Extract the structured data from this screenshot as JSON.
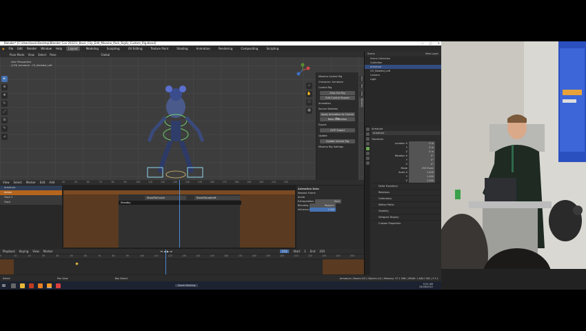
{
  "window": {
    "title": "Blender* [C:\\Users\\kock\\Desktop\\Blender Con 2022\\1_Basic_Clip_Edit_Mixamo_Pack_Rigify_Custom_Rig.blend]",
    "controls": [
      "—",
      "□",
      "✕"
    ]
  },
  "menubar": {
    "menus": [
      "File",
      "Edit",
      "Render",
      "Window",
      "Help"
    ],
    "workspaces": [
      "Layout",
      "Modeling",
      "Sculpting",
      "UV Editing",
      "Texture Paint",
      "Shading",
      "Animation",
      "Rendering",
      "Compositing",
      "Scripting"
    ],
    "active_workspace": "Layout"
  },
  "viewport": {
    "mode": "Pose Mode",
    "menus": [
      "View",
      "Select",
      "Pose"
    ],
    "transform": "Global",
    "overlay_text": [
      "User Perspective",
      "(153) Armature : CH_Modded_Left"
    ]
  },
  "npanel": {
    "items": [
      "Mixamo Control Rig",
      "Character: Armature",
      "Control Rig",
      "Zero Out Rig",
      "Edit Control Shapes",
      "Animation",
      "Source Skeleton",
      "Apply Animation to Control Rig",
      "Bake Animation",
      "Export",
      "GLTF Export",
      "Update",
      "Update Control Rig",
      "Mixamo Rig Settings"
    ],
    "tabs": [
      "Item",
      "Tool",
      "View",
      "Mixamo"
    ]
  },
  "nla": {
    "menus": [
      "View",
      "Select",
      "Marker",
      "Edit",
      "Add"
    ],
    "tracks": [
      "Armature",
      "Action",
      "Track 2",
      "Track"
    ],
    "ruler": [
      "40",
      "50",
      "60",
      "70",
      "80",
      "90",
      "100",
      "110",
      "120",
      "130",
      "140",
      "150",
      "160",
      "170",
      "180",
      "190",
      "200",
      "210",
      "220"
    ],
    "strips": [
      "StandToCrouch",
      "StandToLookLeft",
      "Standby"
    ],
    "props": {
      "header": "Animation Data",
      "action": "dumb",
      "extrapolation_label": "Extrapolation",
      "extrapolation": "Hold",
      "blending_label": "Blending",
      "blending": "Replace",
      "influence_label": "Influence",
      "influence": "1.000",
      "tab": "Nearest Frame"
    }
  },
  "timeline": {
    "menus": [
      "Playback",
      "Keying",
      "View",
      "Marker"
    ],
    "frame_current": "153",
    "start": "1",
    "end": "250",
    "start_label": "Start",
    "end_label": "End",
    "ruler": [
      "0",
      "10",
      "20",
      "30",
      "40",
      "50",
      "60",
      "70",
      "80",
      "90",
      "100",
      "110",
      "120",
      "130",
      "140",
      "150",
      "160",
      "170",
      "180",
      "190",
      "200",
      "210",
      "220",
      "230",
      "240",
      "250"
    ]
  },
  "outliner": {
    "title": "Scene",
    "view_layer": "View Layer",
    "rows": [
      "Scene Collection",
      "Collection",
      "Armature",
      "CH_Modded_Left",
      "Camera",
      "Light"
    ],
    "selected": "Armature"
  },
  "properties": {
    "object": "Armature",
    "sub": "Armature",
    "transform": "Transform",
    "fields": [
      {
        "label": "Location X",
        "value": "0 m"
      },
      {
        "label": "Y",
        "value": "0 m"
      },
      {
        "label": "Z",
        "value": "0 m"
      },
      {
        "label": "Rotation X",
        "value": "0°"
      },
      {
        "label": "Y",
        "value": "0°"
      },
      {
        "label": "Z",
        "value": "0°"
      },
      {
        "label": "Mode",
        "value": "XYZ Euler"
      },
      {
        "label": "Scale X",
        "value": "1.000"
      },
      {
        "label": "Y",
        "value": "1.000"
      },
      {
        "label": "Z",
        "value": "1.000"
      }
    ],
    "sections": [
      "Delta Transform",
      "Relations",
      "Collections",
      "Motion Paths",
      "Visibility",
      "Viewport Display",
      "Custom Properties"
    ]
  },
  "statusbar": {
    "left": "Select",
    "middle": "Pan View",
    "right": "Box Select",
    "info": "Armature | Bones:0/0 | Objects:1/4 | Memory: 37.1 MiB | VRAM: 1.6/8.0 GiB | 3.3.1"
  },
  "taskbar": {
    "active_app": "Zoom Meeting",
    "time": "9:25 AM",
    "date": "10/28/2022"
  }
}
